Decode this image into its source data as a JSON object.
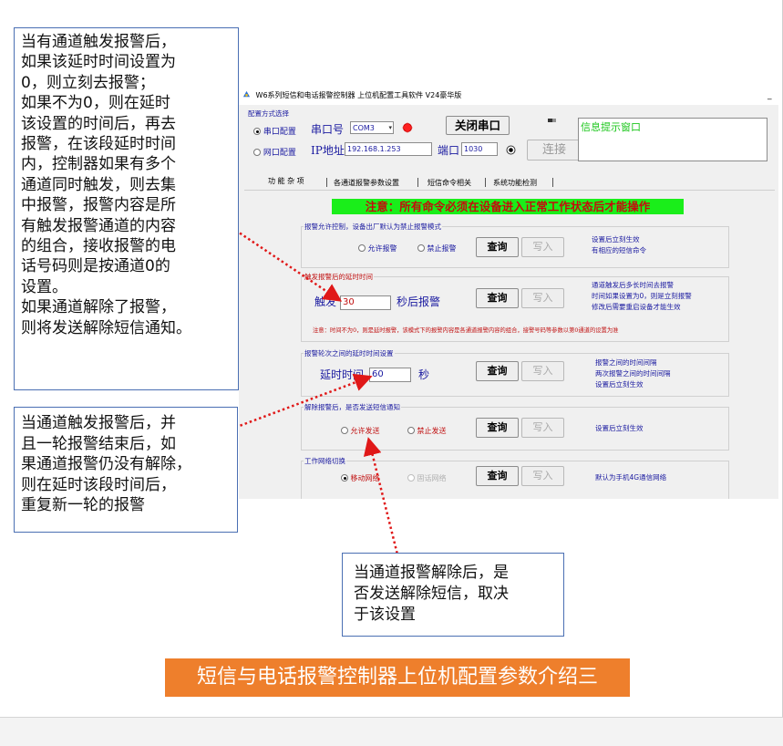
{
  "annotations": {
    "delay_alarm": "当有通道触发报警后，\n如果该延时时间设置为\n0，则立刻去报警；\n如果不为0，则在延时\n该设置的时间后，再去\n报警，在该段延时时间\n内，控制器如果有多个\n通道同时触发，则去集\n中报警，报警内容是所\n有触发报警通道的内容\n的组合，接收报警的电\n话号码则是按通道0的\n设置。\n如果通道解除了报警，\n则将发送解除短信通知。",
    "repeat_alarm": "当通道触发报警后，并\n且一轮报警结束后，如\n果通道报警仍没有解除，\n则在延时该段时间后，\n重复新一轮的报警",
    "release_sms": "当通道报警解除后，是\n否发送解除短信，取决\n于该设置",
    "caption": "短信与电话报警控制器上位机配置参数介绍三"
  },
  "window": {
    "title": "W6系列短信和电话报警控制器 上位机配置工具软件 V24豪华版",
    "minimize": "_"
  },
  "config": {
    "legend": "配置方式选择",
    "serial_option": "串口配置",
    "serial_port_label": "串口号",
    "serial_port_value": "COM3",
    "close_port_button": "关闭串口",
    "network_option": "网口配置",
    "ip_label": "IP地址",
    "ip_value": "192.168.1.253",
    "port_label": "端口",
    "port_value": "1030",
    "connect_button": "连接",
    "info_box": "信息提示窗口"
  },
  "tabs": [
    "功 能 杂 项",
    "各通道报警参数设置",
    "短信命令相关",
    "系统功能检测"
  ],
  "notice": "注意：所有命令必须在设备进入正常工作状态后才能操作",
  "groups": {
    "alarm_permit": {
      "legend": "报警允许控制，设备出厂默认为禁止报警模式",
      "allow": "允许报警",
      "forbid": "禁止报警",
      "query": "查询",
      "write": "写入",
      "hint": "设置后立刻生效\n有相应的短信命令"
    },
    "trigger_delay": {
      "legend": "触发报警后的延时时间",
      "prefix": "触发",
      "value": "30",
      "suffix": "秒后报警",
      "query": "查询",
      "write": "写入",
      "hint": "通道触发后多长时间去报警\n时间如果设置为0，则是立刻报警\n修改后需要重启设备才能生效",
      "note": "注意：时间不为0，则是延时报警，该模式下的报警内容是各通道报警内容的组合，接警号码等参数以第0通道的设置为准"
    },
    "round_interval": {
      "legend": "报警轮次之间的延时时间设置",
      "prefix": "延时时间",
      "value": "60",
      "suffix": "秒",
      "query": "查询",
      "write": "写入",
      "hint": "报警之间的时间间隔\n两次报警之间的时间间隔\n设置后立刻生效"
    },
    "release_sms": {
      "legend": "解除报警后，是否发送短信通知",
      "allow": "允许发送",
      "forbid": "禁止发送",
      "query": "查询",
      "write": "写入",
      "hint": "设置后立刻生效"
    },
    "network": {
      "legend": "工作网络切换",
      "mobile": "移动网络",
      "fixed": "固话网络",
      "query": "查询",
      "write": "写入",
      "hint": "默认为手机4G通信网络"
    }
  },
  "colors": {
    "callout_border": "#4a6fb3",
    "arrow": "#e01818",
    "caption_bg": "#ee7f2c",
    "notice_bg": "#1aee1a",
    "notice_text": "#c40c0c",
    "label_blue": "#1a1aa0"
  }
}
